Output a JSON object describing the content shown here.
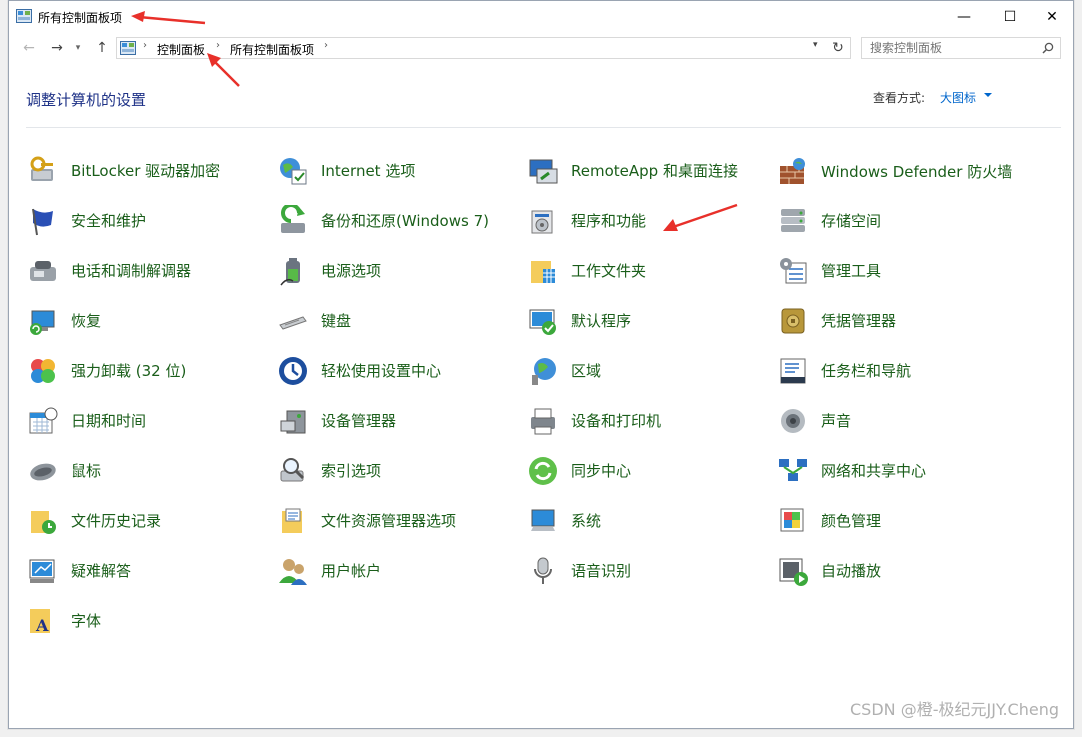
{
  "window": {
    "title": "所有控制面板项",
    "min_glyph": "—",
    "max_glyph": "☐",
    "close_glyph": "✕"
  },
  "nav": {
    "back_glyph": "←",
    "forward_glyph": "→",
    "recent_glyph": "▾",
    "up_glyph": "↑",
    "breadcrumbs": [
      "控制面板",
      "所有控制面板项"
    ],
    "sep": "›",
    "dropdown_glyph": "▾",
    "refresh_glyph": "↻",
    "search_placeholder": "搜索控制面板"
  },
  "header": {
    "title": "调整计算机的设置",
    "view_label": "查看方式:",
    "view_value": "大图标"
  },
  "items": [
    {
      "label": "BitLocker 驱动器加密",
      "icon": "bitlocker-icon"
    },
    {
      "label": "Internet 选项",
      "icon": "internet-options-icon"
    },
    {
      "label": "RemoteApp 和桌面连接",
      "icon": "remoteapp-icon"
    },
    {
      "label": "Windows Defender 防火墙",
      "icon": "firewall-icon"
    },
    {
      "label": "安全和维护",
      "icon": "security-flag-icon"
    },
    {
      "label": "备份和还原(Windows 7)",
      "icon": "backup-icon"
    },
    {
      "label": "程序和功能",
      "icon": "programs-icon"
    },
    {
      "label": "存储空间",
      "icon": "storage-icon"
    },
    {
      "label": "电话和调制解调器",
      "icon": "phone-modem-icon"
    },
    {
      "label": "电源选项",
      "icon": "power-icon"
    },
    {
      "label": "工作文件夹",
      "icon": "work-folders-icon"
    },
    {
      "label": "管理工具",
      "icon": "admin-tools-icon"
    },
    {
      "label": "恢复",
      "icon": "recovery-icon"
    },
    {
      "label": "键盘",
      "icon": "keyboard-icon"
    },
    {
      "label": "默认程序",
      "icon": "default-programs-icon"
    },
    {
      "label": "凭据管理器",
      "icon": "credential-icon"
    },
    {
      "label": "强力卸载 (32 位)",
      "icon": "uninstaller-icon"
    },
    {
      "label": "轻松使用设置中心",
      "icon": "ease-of-access-icon"
    },
    {
      "label": "区域",
      "icon": "region-icon"
    },
    {
      "label": "任务栏和导航",
      "icon": "taskbar-icon"
    },
    {
      "label": "日期和时间",
      "icon": "datetime-icon"
    },
    {
      "label": "设备管理器",
      "icon": "device-manager-icon"
    },
    {
      "label": "设备和打印机",
      "icon": "printer-icon"
    },
    {
      "label": "声音",
      "icon": "sound-icon"
    },
    {
      "label": "鼠标",
      "icon": "mouse-icon"
    },
    {
      "label": "索引选项",
      "icon": "indexing-icon"
    },
    {
      "label": "同步中心",
      "icon": "sync-icon"
    },
    {
      "label": "网络和共享中心",
      "icon": "network-icon"
    },
    {
      "label": "文件历史记录",
      "icon": "file-history-icon"
    },
    {
      "label": "文件资源管理器选项",
      "icon": "explorer-options-icon"
    },
    {
      "label": "系统",
      "icon": "system-icon"
    },
    {
      "label": "颜色管理",
      "icon": "color-management-icon"
    },
    {
      "label": "疑难解答",
      "icon": "troubleshoot-icon"
    },
    {
      "label": "用户帐户",
      "icon": "user-accounts-icon"
    },
    {
      "label": "语音识别",
      "icon": "speech-icon"
    },
    {
      "label": "自动播放",
      "icon": "autoplay-icon"
    },
    {
      "label": "字体",
      "icon": "fonts-icon"
    }
  ],
  "watermark": "CSDN @橙-极纪元JJY.Cheng",
  "colors": {
    "link_green": "#1a5e1a",
    "title_blue": "#1e3287",
    "accent_blue": "#0066cc",
    "annotation_red": "#e8302a"
  }
}
